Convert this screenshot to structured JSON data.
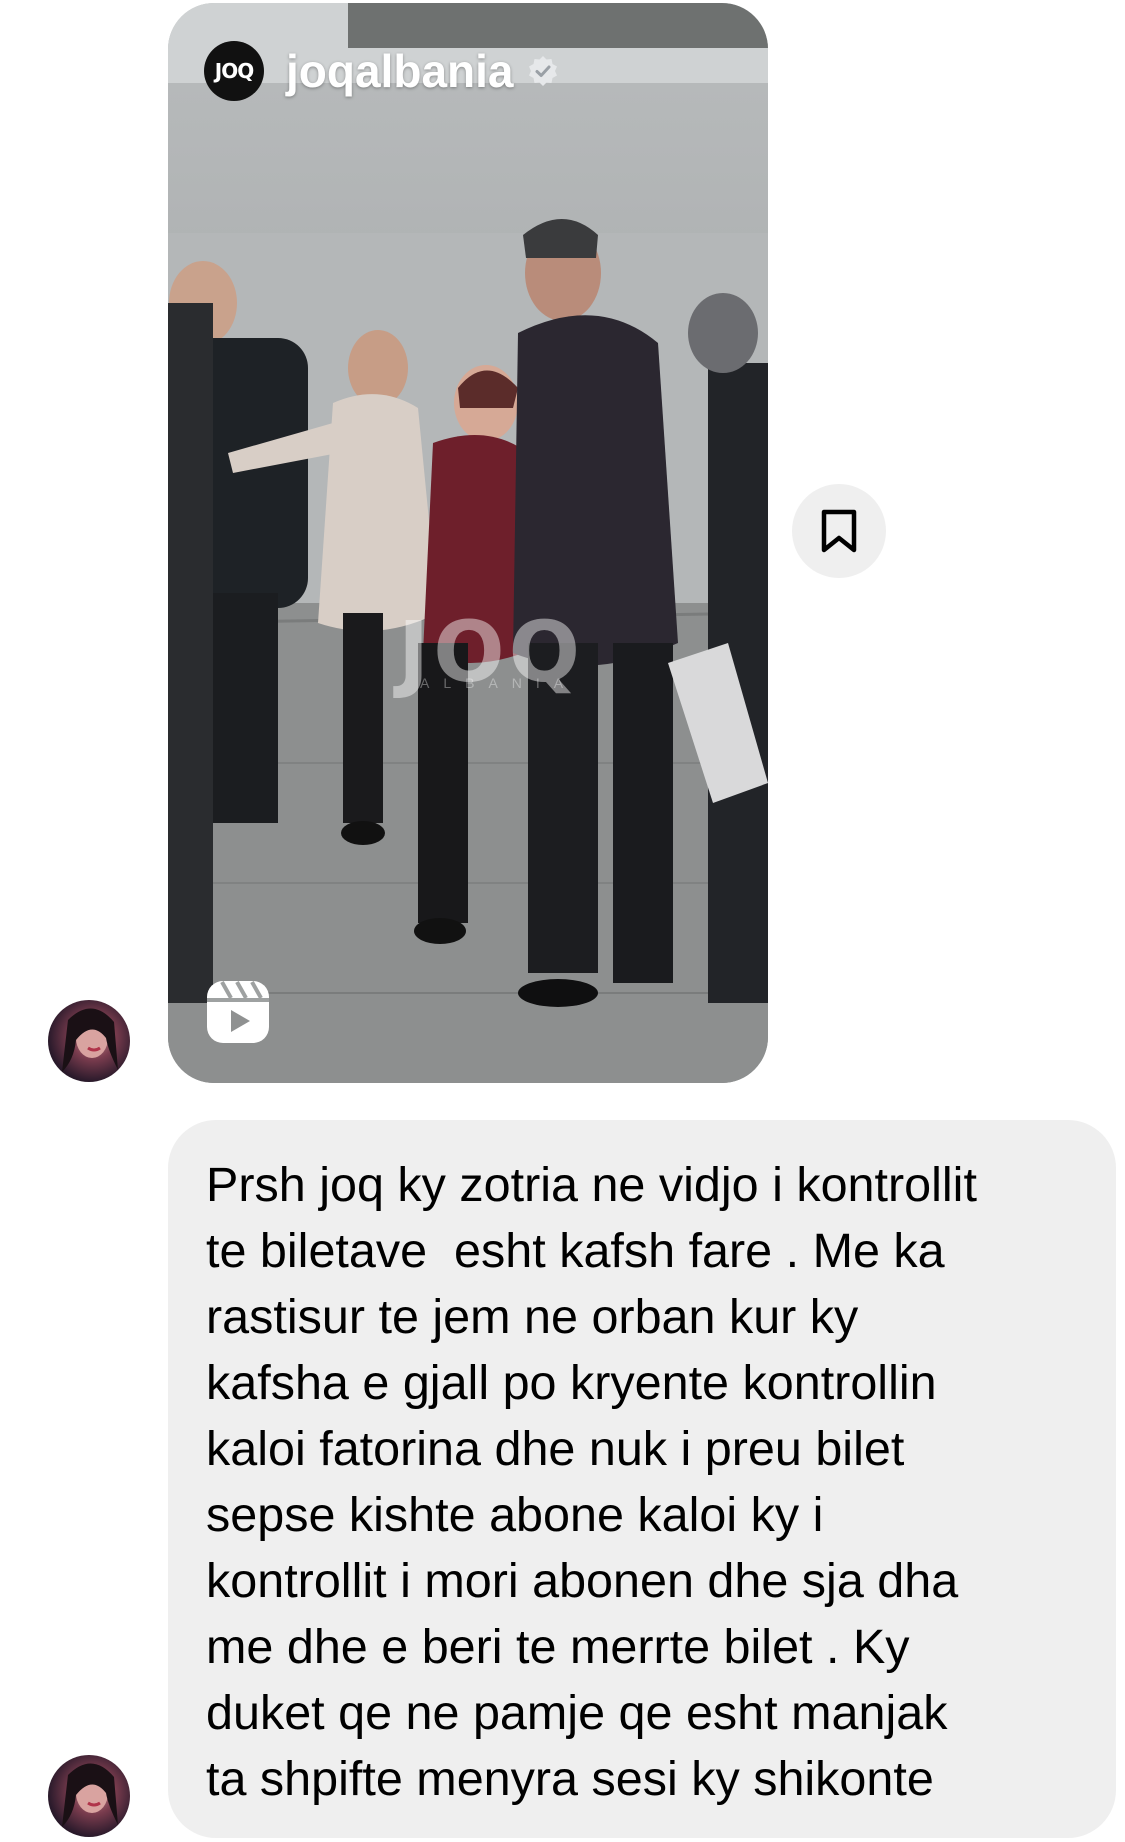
{
  "reel": {
    "username": "joqalbania",
    "avatar_text": "JOQ",
    "watermark": "JOQ",
    "watermark_sub": "ALBANIA",
    "verified_icon": "verified-badge-icon",
    "reels_icon": "reels-icon"
  },
  "save_button": {
    "icon": "bookmark-icon"
  },
  "message": {
    "text": "Prsh joq ky zotria ne vidjo i kontrollit\nte biletave  esht kafsh fare . Me ka\nrastisur te jem ne orban kur ky\nkafsha e gjall po kryente kontrollin\nkaloi fatorina dhe nuk i preu bilet\nsepse kishte abone kaloi ky i\nkontrollit i mori abonen dhe sja dha\nme dhe e beri te merrte bilet . Ky\nduket qe ne pamje qe esht manjak\nta shpifte menyra sesi ky shikonte"
  },
  "colors": {
    "bubble_background": "#efefef",
    "save_button_background": "#efefef",
    "text": "#000000"
  }
}
